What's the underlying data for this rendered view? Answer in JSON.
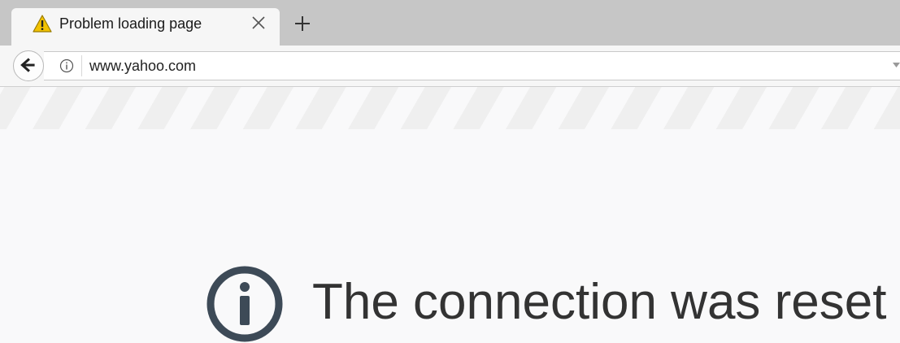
{
  "tab": {
    "title": "Problem loading page",
    "icon": "warning-icon",
    "close_icon": "close-icon",
    "new_tab_icon": "plus-icon"
  },
  "navbar": {
    "back_icon": "back-arrow-icon",
    "info_icon": "info-icon",
    "url": "www.yahoo.com",
    "dropdown_icon": "chevron-down-icon"
  },
  "error_page": {
    "icon": "info-circle-icon",
    "title": "The connection was reset"
  },
  "colors": {
    "tabstrip_bg": "#c6c6c6",
    "warning_yellow": "#f2c200",
    "error_icon": "#3d4a57",
    "page_bg": "#f9f9fa"
  }
}
